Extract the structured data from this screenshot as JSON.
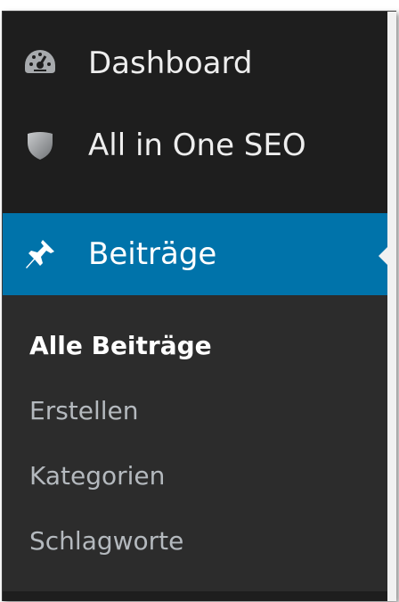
{
  "menu": {
    "items": [
      {
        "label": "Dashboard",
        "icon": "dashboard-icon"
      },
      {
        "label": "All in One SEO",
        "icon": "shield-icon"
      },
      {
        "label": "Beiträge",
        "icon": "pushpin-icon",
        "active": true
      }
    ],
    "submenu": [
      {
        "label": "Alle Beiträge",
        "current": true
      },
      {
        "label": "Erstellen"
      },
      {
        "label": "Kategorien"
      },
      {
        "label": "Schlagworte"
      }
    ]
  },
  "colors": {
    "menu_background": "#1e1e1e",
    "submenu_background": "#2c2c2c",
    "active_accent": "#0073aa",
    "text": "#eeeeee",
    "submenu_text": "#b4b9be"
  }
}
